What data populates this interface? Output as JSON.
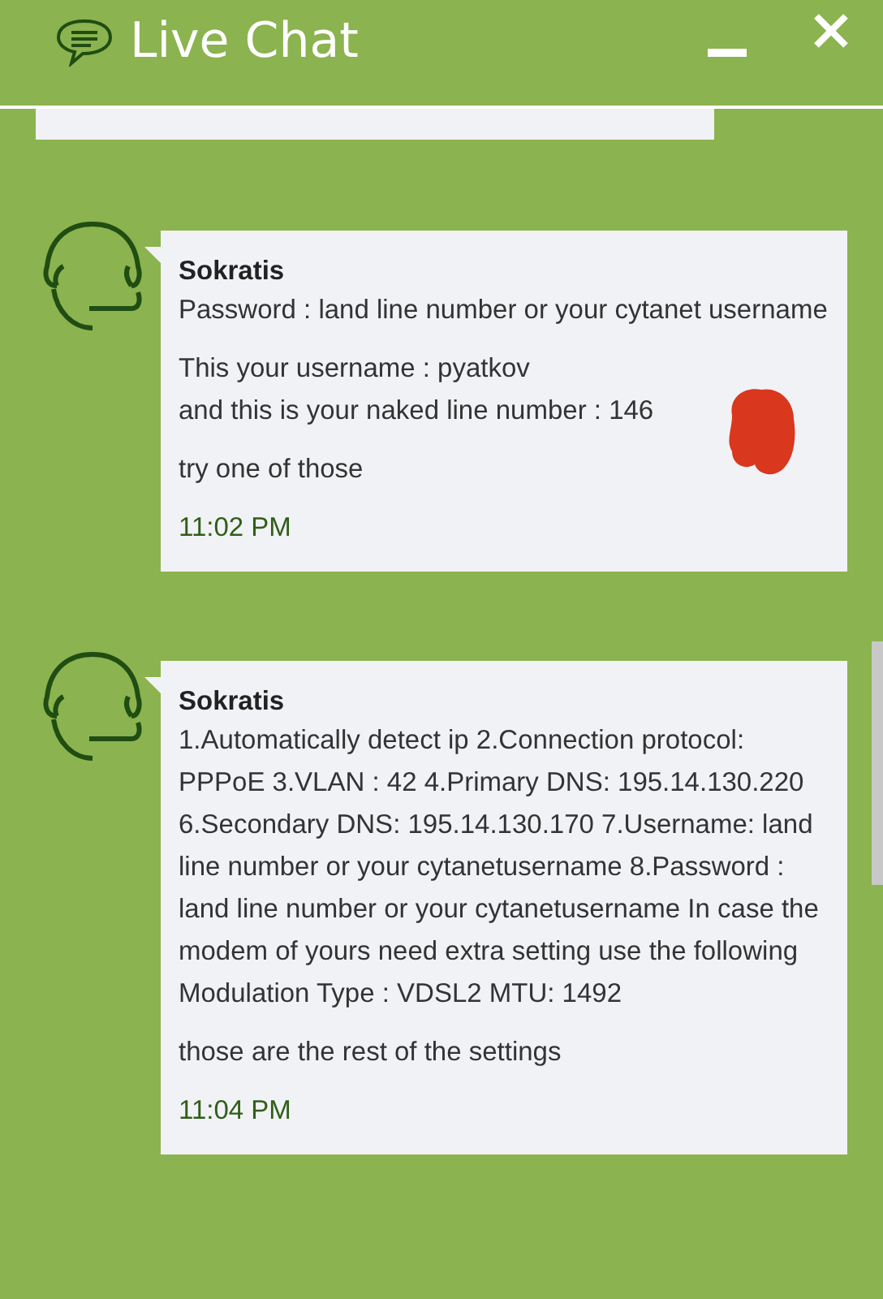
{
  "header": {
    "title": "Live Chat"
  },
  "messages": [
    {
      "sender": "Sokratis",
      "paragraphs": [
        {
          "text": "Password : land line number or your cytanet username",
          "redacted": false
        },
        {
          "text": "This your username : pyatkov\nand this is your naked line number : 146",
          "redacted": true
        },
        {
          "text": "try one of those",
          "redacted": false
        }
      ],
      "time": "11:02 PM"
    },
    {
      "sender": "Sokratis",
      "paragraphs": [
        {
          "text": "1.Automatically detect ip 2.Connection protocol: PPPoE 3.VLAN : 42 4.Primary DNS: 195.14.130.220 6.Secondary DNS: 195.14.130.170 7.Username: land line number or your cytanetusername 8.Password : land line number or your cytanetusername In case the modem of yours need extra setting use the following Modulation Type : VDSL2 MTU: 1492",
          "redacted": false
        },
        {
          "text": "those are the rest of the settings",
          "redacted": false
        }
      ],
      "time": "11:04 PM"
    }
  ]
}
